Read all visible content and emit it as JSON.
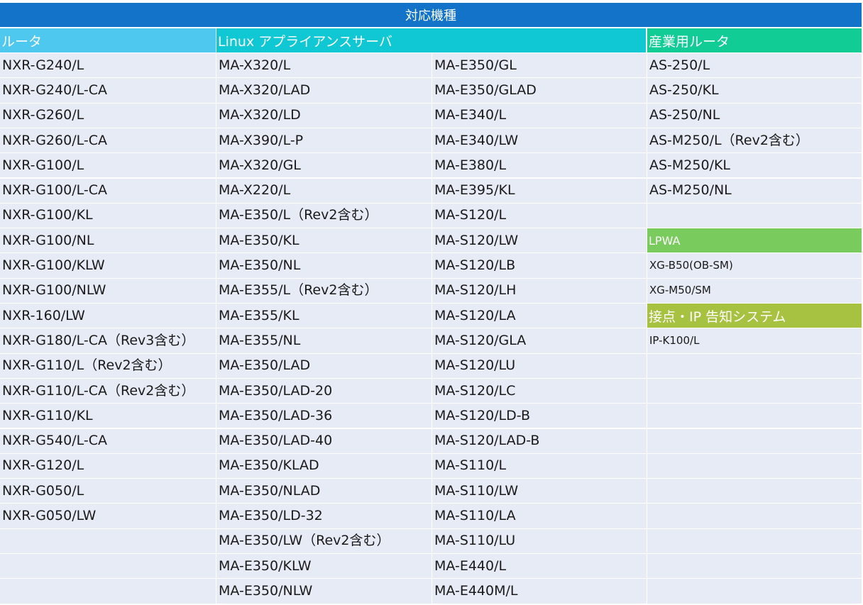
{
  "title": "対応機種",
  "headers": {
    "router": "ルータ",
    "linux": "Linux アプライアンスサーバ",
    "industrial": "産業用ルータ",
    "lpwa": "LPWA",
    "contact_ip": "接点・IP 告知システム"
  },
  "colors": {
    "title_bg": "#1273c9",
    "router_header": "#4ec8ee",
    "linux_header": "#10c8d4",
    "industrial_header": "#12cc95",
    "lpwa_header": "#7acb5d",
    "contact_header": "#a7c240",
    "cell_bg": "#e6ebf5"
  },
  "routers": [
    "NXR-G240/L",
    "NXR-G240/L-CA",
    "NXR-G260/L",
    "NXR-G260/L-CA",
    "NXR-G100/L",
    "NXR-G100/L-CA",
    "NXR-G100/KL",
    "NXR-G100/NL",
    "NXR-G100/KLW",
    "NXR-G100/NLW",
    "NXR-160/LW",
    "NXR-G180/L-CA（Rev3含む）",
    "NXR-G110/L（Rev2含む）",
    "NXR-G110/L-CA（Rev2含む）",
    "NXR-G110/KL",
    "NXR-G540/L-CA",
    "NXR-G120/L",
    "NXR-G050/L",
    "NXR-G050/LW",
    "",
    "",
    ""
  ],
  "linux_col1": [
    "MA-X320/L",
    "MA-X320/LAD",
    "MA-X320/LD",
    "MA-X390/L-P",
    "MA-X320/GL",
    "MA-X220/L",
    "MA-E350/L（Rev2含む）",
    "MA-E350/KL",
    "MA-E350/NL",
    "MA-E355/L（Rev2含む）",
    "MA-E355/KL",
    "MA-E355/NL",
    "MA-E350/LAD",
    "MA-E350/LAD-20",
    "MA-E350/LAD-36",
    "MA-E350/LAD-40",
    "MA-E350/KLAD",
    "MA-E350/NLAD",
    "MA-E350/LD-32",
    "MA-E350/LW（Rev2含む）",
    "MA-E350/KLW",
    "MA-E350/NLW"
  ],
  "linux_col2": [
    "MA-E350/GL",
    "MA-E350/GLAD",
    "MA-E340/L",
    "MA-E340/LW",
    "MA-E380/L",
    "MA-E395/KL",
    "MA-S120/L",
    "MA-S120/LW",
    "MA-S120/LB",
    "MA-S120/LH",
    "MA-S120/LA",
    "MA-S120/GLA",
    "MA-S120/LU",
    "MA-S120/LC",
    "MA-S120/LD-B",
    "MA-S120/LAD-B",
    "MA-S110/L",
    "MA-S110/LW",
    "MA-S110/LA",
    "MA-S110/LU",
    "MA-E440/L",
    "MA-E440M/L"
  ],
  "industrial": [
    "AS-250/L",
    "AS-250/KL",
    "AS-250/NL",
    "AS-M250/L（Rev2含む）",
    "AS-M250/KL",
    "AS-M250/NL",
    ""
  ],
  "lpwa_items": [
    "XG-B50(OB-SM)",
    "XG-M50/SM"
  ],
  "contact_items": [
    "IP-K100/L"
  ]
}
